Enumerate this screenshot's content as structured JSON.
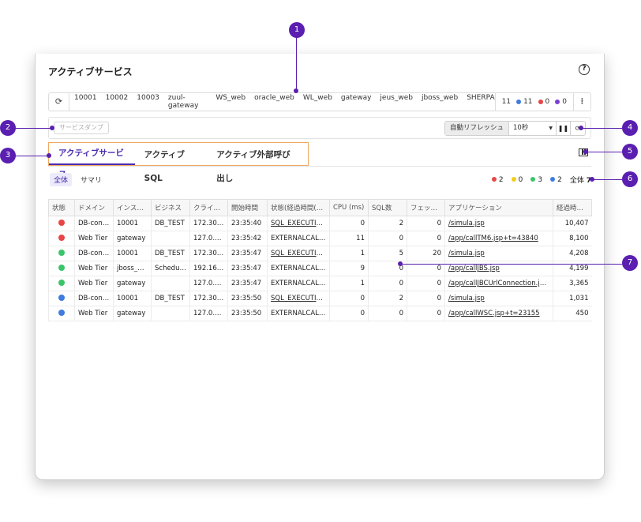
{
  "window": {
    "title": "アクティブサービス"
  },
  "agents": [
    "10001",
    "10002",
    "10003",
    "zuul-gateway",
    "WS_web",
    "oracle_web",
    "WL_web",
    "gateway",
    "jeus_web",
    "jboss_web",
    "SHERPA"
  ],
  "agent_counts": {
    "total": "11",
    "blue": "11",
    "red": "0",
    "purple": "0"
  },
  "toolbar": {
    "dump_label": "サービスダンプ",
    "auto_label": "自動リフレッシュ",
    "interval": "10秒"
  },
  "tabs": [
    "アクティブサービス",
    "アクティブSQL",
    "アクティブ外部呼び出し"
  ],
  "filters": [
    "全体",
    "サマリ"
  ],
  "status_counts": {
    "red": "2",
    "yellow": "0",
    "green": "3",
    "blue": "2",
    "total_label": "全体",
    "total": "7"
  },
  "columns": [
    "状態",
    "ドメイン",
    "インス…",
    "ビジネス",
    "クライ…",
    "開始時間",
    "状態(経過時間(…",
    "CPU (ms)",
    "SQL数",
    "フェッ…",
    "アプリケーション",
    "経過時…"
  ],
  "rows": [
    {
      "status": "red",
      "domain": "DB-con…",
      "instance": "10001",
      "business": "DB_TEST",
      "client": "172.30.0.1",
      "start": "23:35:40",
      "state": "SQL_EXECUTIN…",
      "cpu": "0",
      "sql": "2",
      "fetch": "0",
      "app": "/simula.jsp",
      "elapsed": "10,407"
    },
    {
      "status": "red",
      "domain": "Web Tier",
      "instance": "gateway",
      "business": "",
      "client": "127.0.0.1",
      "start": "23:35:42",
      "state": "EXTERNALCALL…",
      "cpu": "11",
      "sql": "0",
      "fetch": "0",
      "app": "/app/callTM6.jsp+t=43840",
      "elapsed": "8,100"
    },
    {
      "status": "green",
      "domain": "DB-con…",
      "instance": "10001",
      "business": "DB_TEST",
      "client": "172.30.0.1",
      "start": "23:35:47",
      "state": "SQL_EXECUTIN…",
      "cpu": "1",
      "sql": "5",
      "fetch": "20",
      "app": "/simula.jsp",
      "elapsed": "4,208"
    },
    {
      "status": "green",
      "domain": "Web Tier",
      "instance": "jboss_…",
      "business": "Schedul…",
      "client": "192.168…",
      "start": "23:35:47",
      "state": "EXTERNALCALL…",
      "cpu": "9",
      "sql": "0",
      "fetch": "0",
      "app": "/app/callJBS.jsp",
      "elapsed": "4,199"
    },
    {
      "status": "green",
      "domain": "Web Tier",
      "instance": "gateway",
      "business": "",
      "client": "127.0.0.1",
      "start": "23:35:47",
      "state": "EXTERNALCALL…",
      "cpu": "1",
      "sql": "0",
      "fetch": "0",
      "app": "/app/callJBCUrlConnection.js…",
      "elapsed": "3,365"
    },
    {
      "status": "blue",
      "domain": "DB-con…",
      "instance": "10001",
      "business": "DB_TEST",
      "client": "172.30.0.1",
      "start": "23:35:50",
      "state": "SQL_EXECUTIN…",
      "cpu": "0",
      "sql": "2",
      "fetch": "0",
      "app": "/simula.jsp",
      "elapsed": "1,031"
    },
    {
      "status": "blue",
      "domain": "Web Tier",
      "instance": "gateway",
      "business": "",
      "client": "127.0.0.1",
      "start": "23:35:50",
      "state": "EXTERNALCALL…",
      "cpu": "0",
      "sql": "0",
      "fetch": "0",
      "app": "/app/callWSC.jsp+t=23155",
      "elapsed": "450"
    }
  ],
  "colors": {
    "red": "#e84545",
    "green": "#3cc46a",
    "blue": "#3f7be0",
    "yellow": "#f2cd1c",
    "purple": "#7a3fd0",
    "accent": "#4a2bb0",
    "callout": "#5a1fb0"
  },
  "callouts": [
    "1",
    "2",
    "3",
    "4",
    "5",
    "6",
    "7"
  ]
}
